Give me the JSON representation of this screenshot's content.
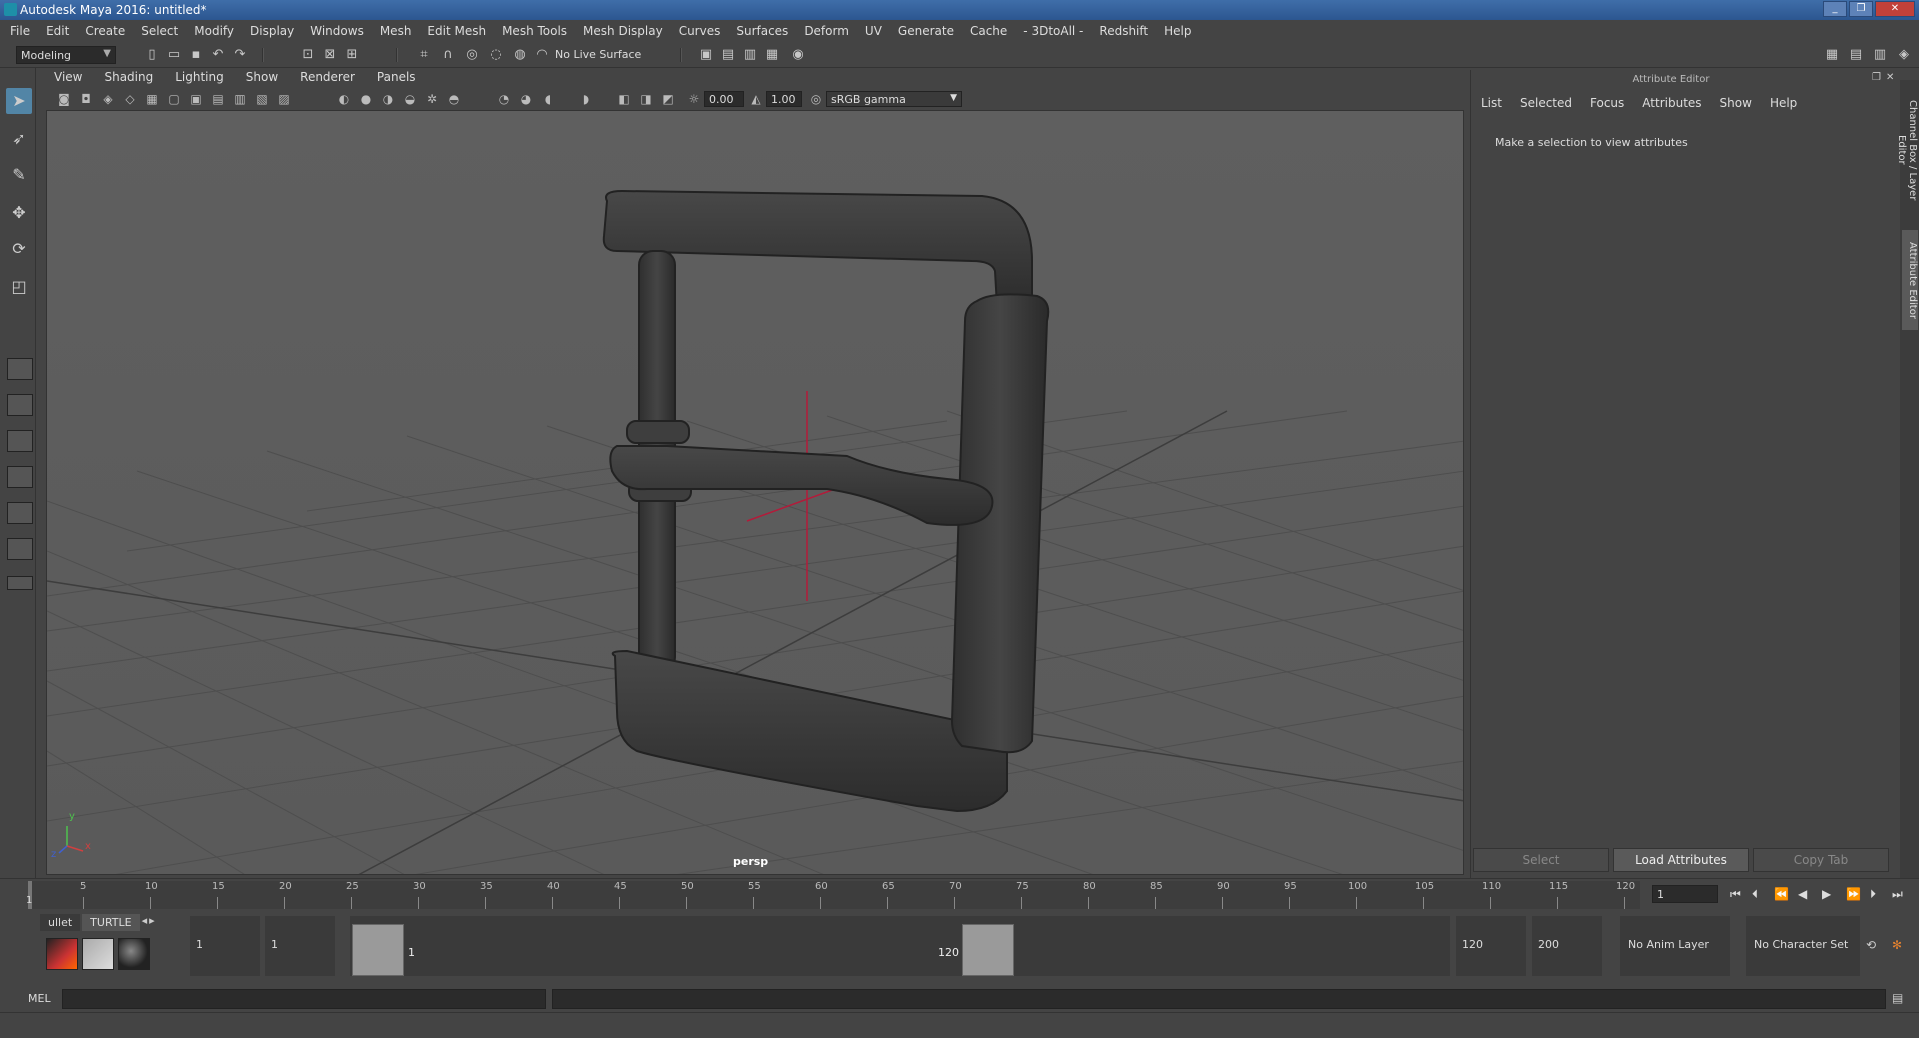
{
  "window": {
    "title": "Autodesk Maya 2016: untitled*",
    "buttons": [
      "_",
      "❐",
      "✕"
    ]
  },
  "menu": [
    "File",
    "Edit",
    "Create",
    "Select",
    "Modify",
    "Display",
    "Windows",
    "Mesh",
    "Edit Mesh",
    "Mesh Tools",
    "Mesh Display",
    "Curves",
    "Surfaces",
    "Deform",
    "UV",
    "Generate",
    "Cache",
    "- 3DtoAll -",
    "Redshift",
    "Help"
  ],
  "statusline": {
    "mode": "Modeling",
    "live_surface": "No Live Surface"
  },
  "viewport": {
    "menu": [
      "View",
      "Shading",
      "Lighting",
      "Show",
      "Renderer",
      "Panels"
    ],
    "exposure": "0.00",
    "gamma": "1.00",
    "color_space": "sRGB gamma",
    "camera": "persp",
    "axis_x": "x",
    "axis_y": "y",
    "axis_z": "z"
  },
  "attribute_editor": {
    "title": "Attribute Editor",
    "tabs": [
      "List",
      "Selected",
      "Focus",
      "Attributes",
      "Show",
      "Help"
    ],
    "message": "Make a selection to view attributes",
    "buttons": {
      "select": "Select",
      "load": "Load Attributes",
      "copy": "Copy Tab"
    },
    "side_tabs": [
      "Channel Box / Layer Editor",
      "Attribute Editor"
    ]
  },
  "timeslider": {
    "start_label": "1",
    "ticks": [
      "5",
      "10",
      "15",
      "20",
      "25",
      "30",
      "35",
      "40",
      "45",
      "50",
      "55",
      "60",
      "65",
      "70",
      "75",
      "80",
      "85",
      "90",
      "95",
      "100",
      "105",
      "110",
      "115",
      "120"
    ],
    "current_frame": "1"
  },
  "range": {
    "shelf_tabs": [
      "ullet",
      "TURTLE"
    ],
    "start": "1",
    "anim_start": "1",
    "range_start": "1",
    "range_end": "120",
    "end": "120",
    "anim_end": "200",
    "anim_layer": "No Anim Layer",
    "character_set": "No Character Set"
  },
  "cmdline": {
    "label": "MEL"
  }
}
